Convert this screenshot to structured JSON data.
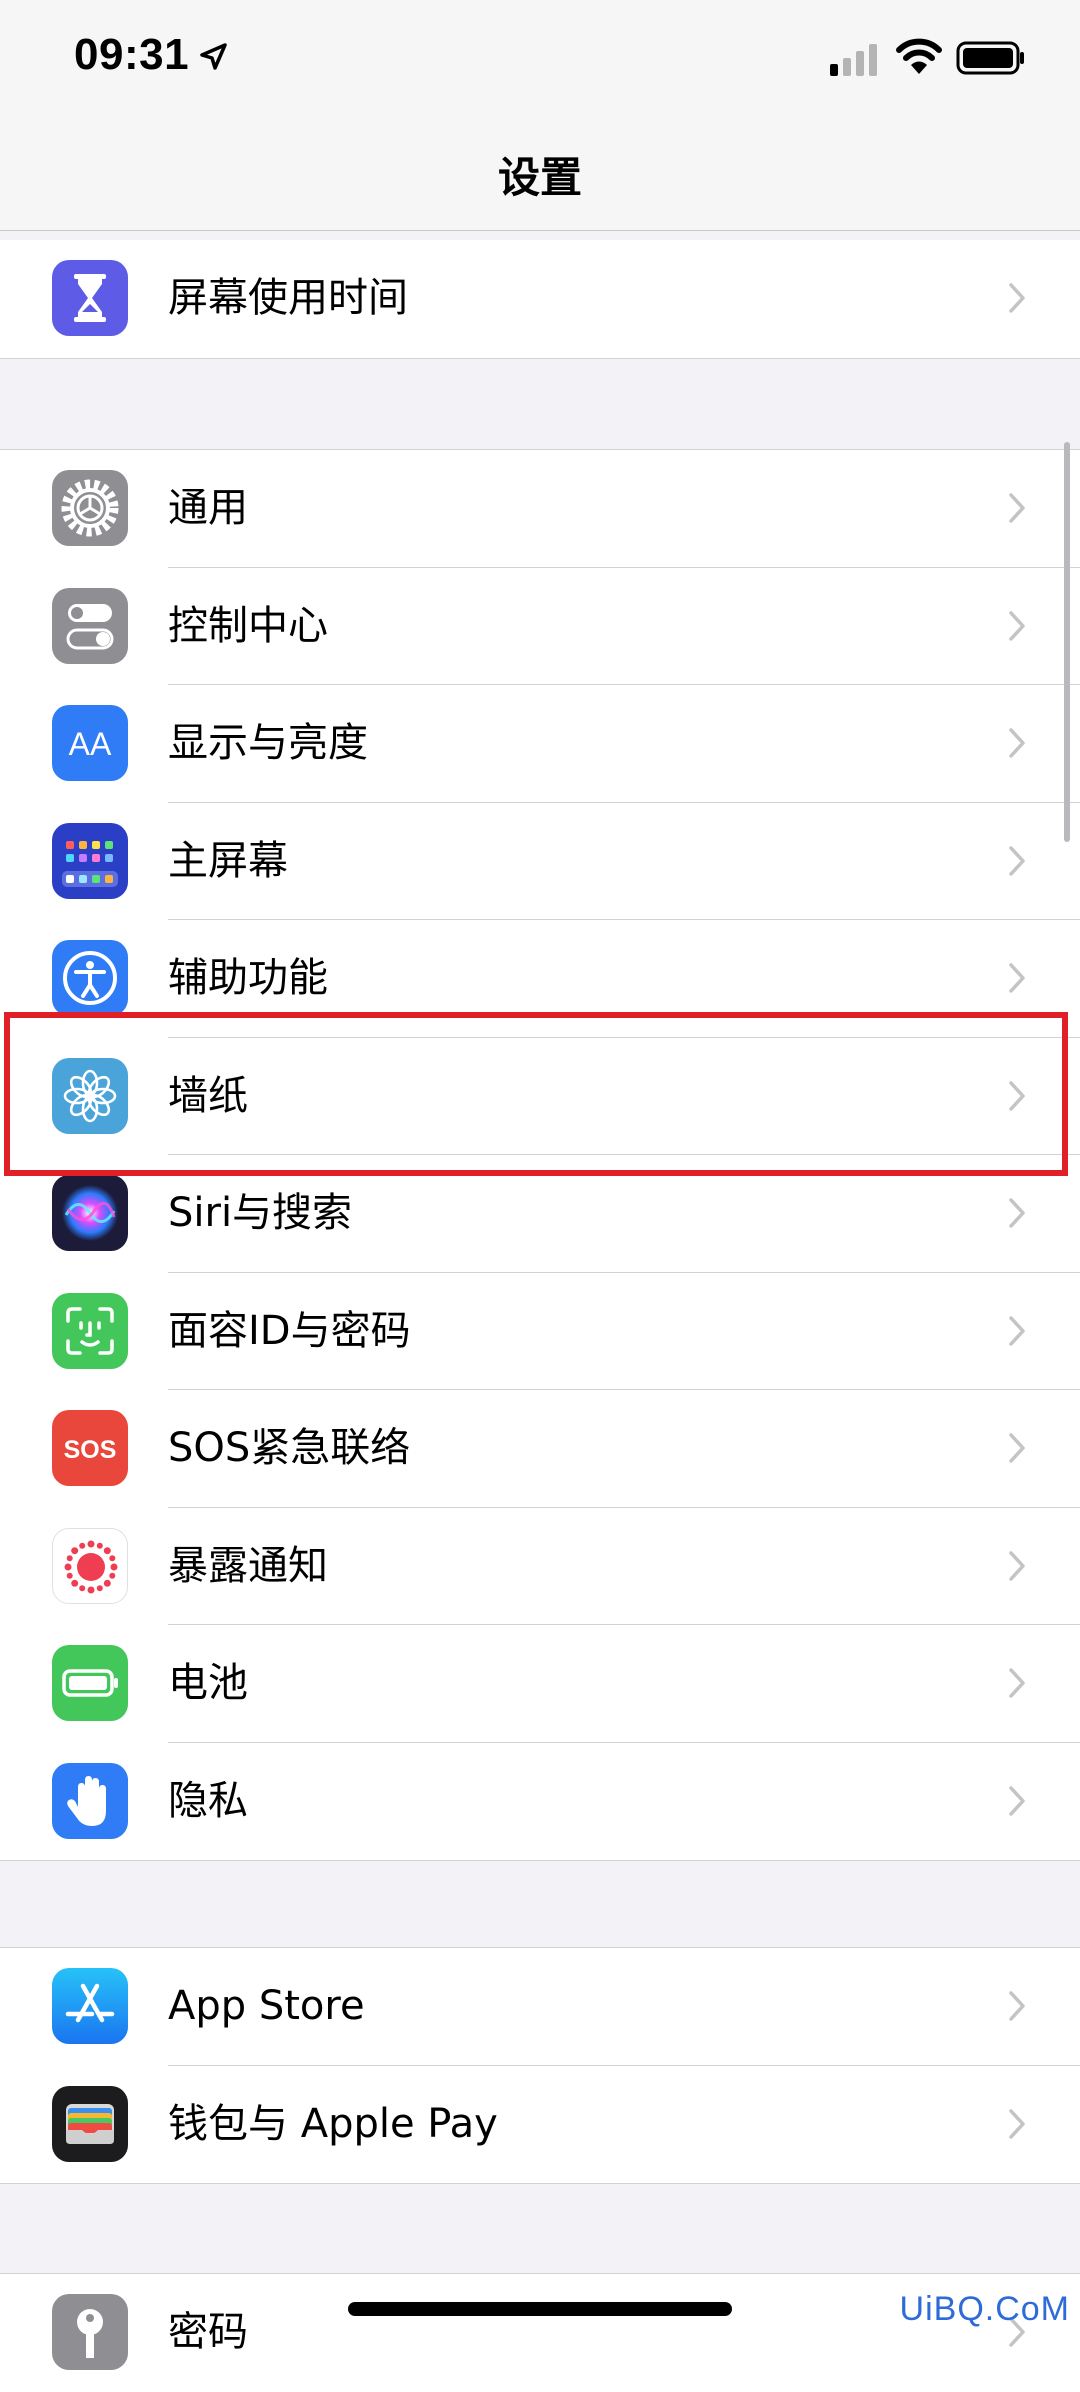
{
  "status_bar": {
    "time": "09:31",
    "icons": [
      "location-arrow-icon",
      "cellular-signal-icon",
      "wifi-icon",
      "battery-icon"
    ]
  },
  "nav": {
    "title": "设置"
  },
  "groups": [
    {
      "items": [
        {
          "label": "屏幕使用时间",
          "icon": "hourglass-icon",
          "icon_color": "#5e5ce6"
        }
      ]
    },
    {
      "items": [
        {
          "label": "通用",
          "icon": "gear-icon",
          "icon_color": "#8e8e93"
        },
        {
          "label": "控制中心",
          "icon": "toggles-icon",
          "icon_color": "#8e8e93"
        },
        {
          "label": "显示与亮度",
          "icon": "text-size-icon",
          "icon_glyph": "AA",
          "icon_color": "#2f7cf6"
        },
        {
          "label": "主屏幕",
          "icon": "home-grid-icon",
          "icon_color": "#2a3fc6"
        },
        {
          "label": "辅助功能",
          "icon": "accessibility-icon",
          "icon_color": "#2f7cf6"
        },
        {
          "label": "墙纸",
          "icon": "flower-icon",
          "icon_color": "#4aa3d9",
          "highlighted": true
        },
        {
          "label": "Siri与搜索",
          "icon": "siri-icon",
          "icon_color": "#1c1c3a"
        },
        {
          "label": "面容ID与密码",
          "icon": "face-id-icon",
          "icon_color": "#43c75a"
        },
        {
          "label": "SOS紧急联络",
          "icon": "sos-icon",
          "icon_glyph": "SOS",
          "icon_color": "#e9463c"
        },
        {
          "label": "暴露通知",
          "icon": "exposure-icon",
          "icon_color": "#ffffff"
        },
        {
          "label": "电池",
          "icon": "battery-app-icon",
          "icon_color": "#43c75a"
        },
        {
          "label": "隐私",
          "icon": "hand-icon",
          "icon_color": "#2f7cf6"
        }
      ]
    },
    {
      "items": [
        {
          "label": "App Store",
          "icon": "app-store-icon",
          "icon_color": "#2f8bf6"
        },
        {
          "label": "钱包与 Apple Pay",
          "icon": "wallet-icon",
          "icon_color": "#1c1c1e"
        }
      ]
    },
    {
      "items": [
        {
          "label": "密码",
          "icon": "key-icon",
          "icon_color": "#8e8e93"
        }
      ]
    }
  ],
  "watermark": "UiBQ.CoM",
  "colors": {
    "highlight": "#e01f26",
    "background": "#f2f2f7",
    "chevron": "#c4c4c7"
  }
}
